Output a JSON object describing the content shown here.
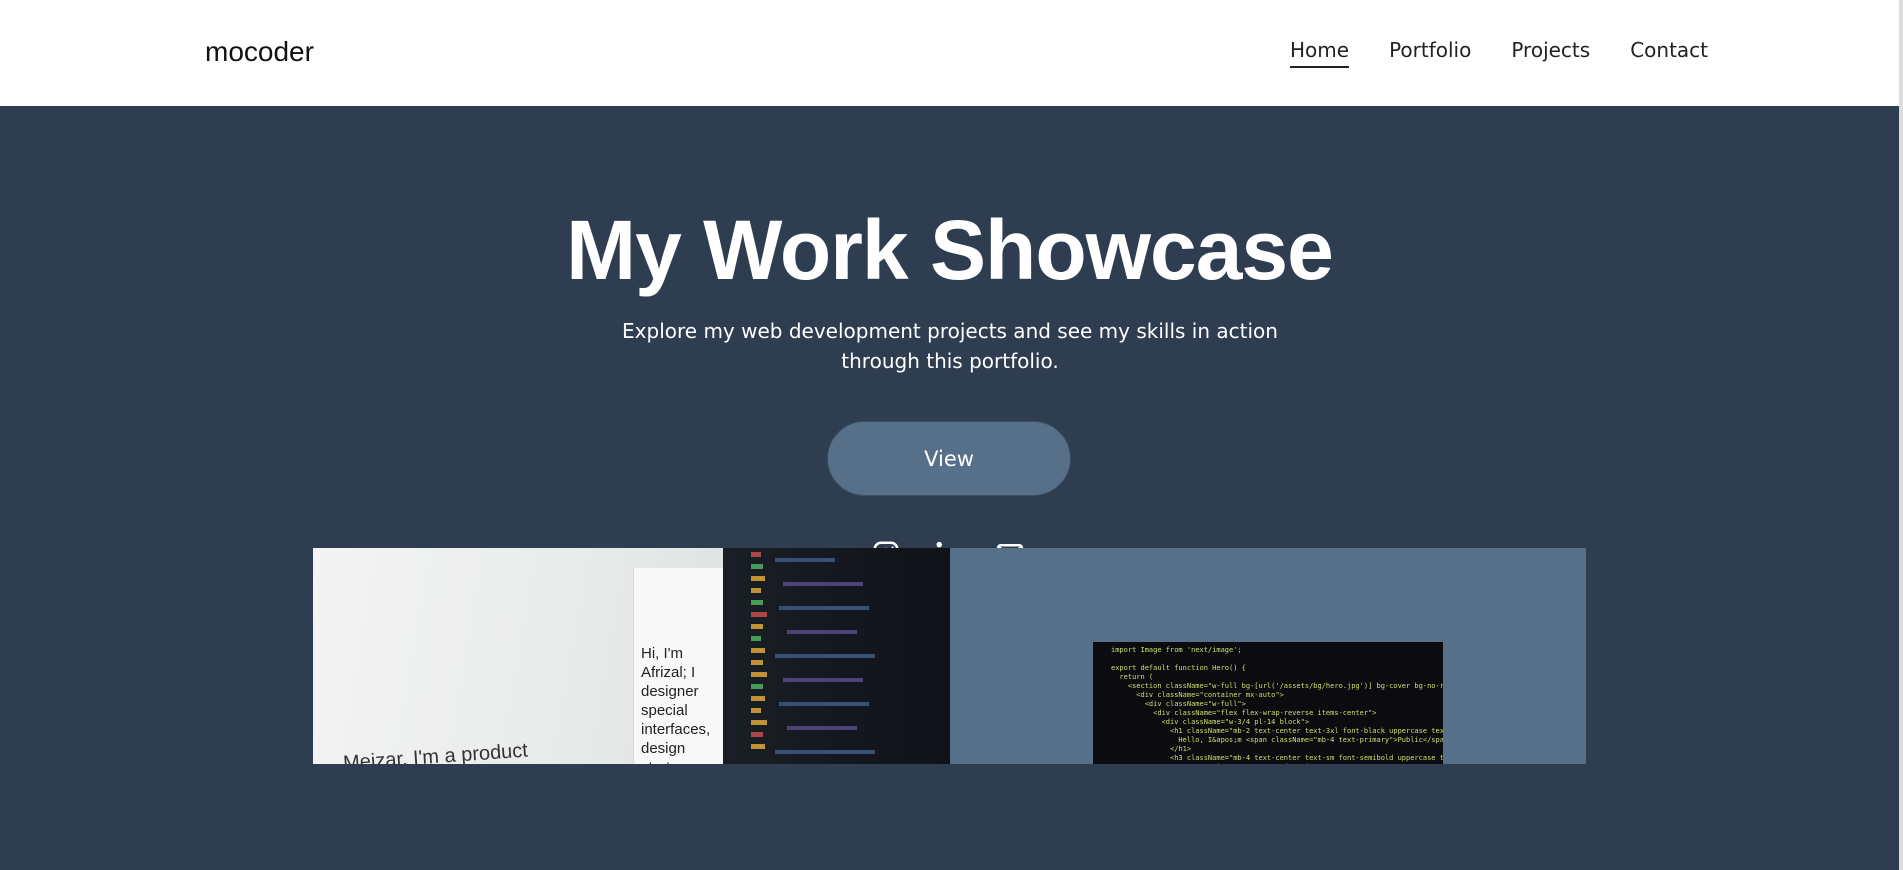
{
  "brand": "mocoder",
  "nav": {
    "home": "Home",
    "portfolio": "Portfolio",
    "projects": "Projects",
    "contact": "Contact"
  },
  "hero": {
    "title": "My Work Showcase",
    "subtitle": "Explore my web development projects and see my skills in action through this portfolio.",
    "button": "View"
  },
  "socials": [
    "instagram-icon",
    "linkedin-icon",
    "mail-icon"
  ],
  "projects": [
    {
      "screenshot_sidebar_text": "Hi, I'm Afrizal; I designer special interfaces, design strategy across industries",
      "screenshot_heading": "Meizar, I'm a product"
    },
    {
      "code": "import Image from 'next/image';\n\nexport default function Hero() {\n  return (\n    <section className=\"w-full bg-[url('/assets/bg/hero.jpg')] bg-cover bg-no-repeat\n      <div className=\"container mx-auto\">\n        <div className=\"w-full\">\n          <div className=\"flex flex-wrap-reverse items-center\">\n            <div className=\"w-3/4 pl-14 block\">\n              <h1 className=\"mb-2 text-center text-3xl font-black uppercase text-c\n                Hello, I&apos;m <span className=\"mb-4 text-primary\">Public</span>\n              </h1>\n              <h3 className=\"mb-4 text-center text-sm font-semibold uppercase tracki\n                UI/UX Designer & Front-End Designer"
    }
  ]
}
